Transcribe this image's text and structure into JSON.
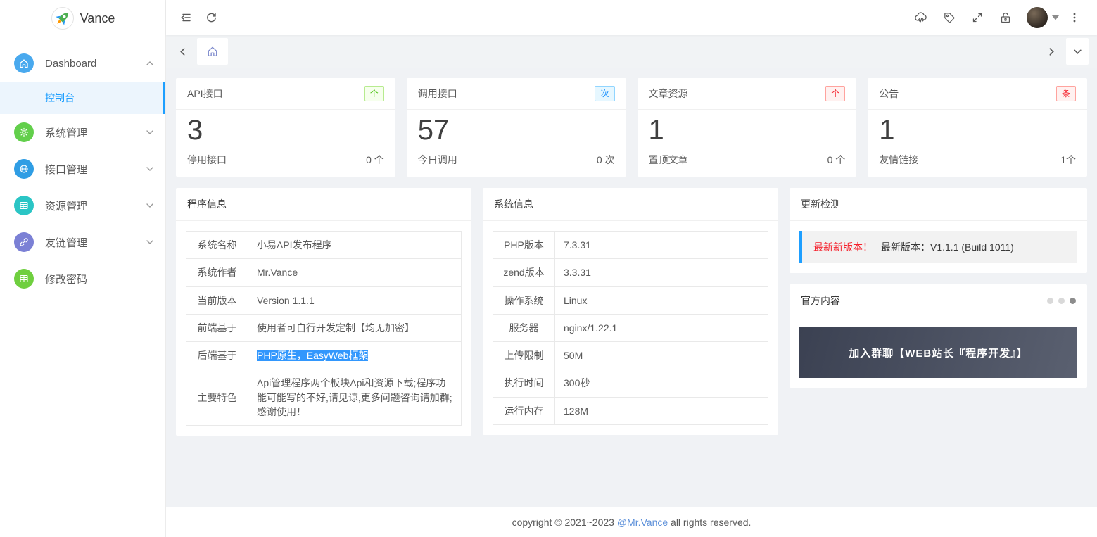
{
  "app_title": "Vance",
  "sidebar": {
    "logo_text": "Vance",
    "menu": [
      {
        "label": "Dashboard",
        "icon": "home-icon",
        "icon_color": "#49a9ee",
        "expanded": true,
        "children": [
          {
            "label": "控制台",
            "active": true
          }
        ]
      },
      {
        "label": "系统管理",
        "icon": "gear-icon",
        "icon_color": "#62cf4b",
        "collapsible": true
      },
      {
        "label": "接口管理",
        "icon": "globe-icon",
        "icon_color": "#2f9de4",
        "collapsible": true
      },
      {
        "label": "资源管理",
        "icon": "table-icon",
        "icon_color": "#2bc5c5",
        "collapsible": true
      },
      {
        "label": "友链管理",
        "icon": "link-icon",
        "icon_color": "#7b80d5",
        "collapsible": true
      },
      {
        "label": "修改密码",
        "icon": "grid-icon",
        "icon_color": "#6fcf3f",
        "collapsible": false
      }
    ]
  },
  "header": {
    "left_icons": [
      "collapse-menu-icon",
      "refresh-icon"
    ],
    "right_icons": [
      "cloud-code-icon",
      "tag-icon",
      "fullscreen-icon",
      "unlock-icon",
      "avatar",
      "caret-down-icon",
      "kebab-menu-icon"
    ]
  },
  "tabstrip": {
    "icons": [
      "chevron-left-icon",
      "home-tab-icon",
      "chevron-right-icon",
      "chevron-down-icon"
    ]
  },
  "stat_cards": [
    {
      "title": "API接口",
      "badge": "个",
      "badge_color": "green",
      "value": "3",
      "footer_label": "停用接口",
      "footer_value": "0 个"
    },
    {
      "title": "调用接口",
      "badge": "次",
      "badge_color": "blue",
      "value": "57",
      "footer_label": "今日调用",
      "footer_value": "0 次"
    },
    {
      "title": "文章资源",
      "badge": "个",
      "badge_color": "red",
      "value": "1",
      "footer_label": "置顶文章",
      "footer_value": "0 个"
    },
    {
      "title": "公告",
      "badge": "条",
      "badge_color": "red",
      "value": "1",
      "footer_label": "友情链接",
      "footer_value": "1个"
    }
  ],
  "program_info": {
    "title": "程序信息",
    "rows": [
      {
        "label": "系统名称",
        "value": "小易API发布程序"
      },
      {
        "label": "系统作者",
        "value": "Mr.Vance"
      },
      {
        "label": "当前版本",
        "value": "Version 1.1.1"
      },
      {
        "label": "前端基于",
        "value": "使用者可自行开发定制【均无加密】"
      },
      {
        "label": "后端基于",
        "value": "PHP原生，EasyWeb框架",
        "highlighted": true
      },
      {
        "label": "主要特色",
        "value": "Api管理程序两个板块Api和资源下载;程序功能可能写的不好,请见谅,更多问题咨询请加群;感谢使用！"
      }
    ]
  },
  "system_info": {
    "title": "系统信息",
    "rows": [
      {
        "label": "PHP版本",
        "value": "7.3.31"
      },
      {
        "label": "zend版本",
        "value": "3.3.31"
      },
      {
        "label": "操作系统",
        "value": "Linux"
      },
      {
        "label": "服务器",
        "value": "nginx/1.22.1"
      },
      {
        "label": "上传限制",
        "value": "50M"
      },
      {
        "label": "执行时间",
        "value": "300秒"
      },
      {
        "label": "运行内存",
        "value": "128M"
      }
    ]
  },
  "update_panel": {
    "title": "更新检测",
    "alert_highlight": "最新新版本！",
    "alert_text": "最新版本：V1.1.1 (Build 1011)"
  },
  "official_panel": {
    "title": "官方内容",
    "dots_total": 3,
    "active_dot_index": 2,
    "banner_text": "加入群聊【WEB站长『程序开发』】"
  },
  "footer": {
    "text_before": "copyright © 2021~2023 ",
    "link": "@Mr.Vance",
    "text_after": " all rights reserved."
  },
  "colors": {
    "primary": "#1e9fff",
    "content_background": "#f0f2f5",
    "selection_highlight": "#3297fd",
    "tag_green": "#52c41a",
    "tag_blue": "#1890ff",
    "tag_red": "#f5222d",
    "banner_gradient_start": "#3b4152",
    "banner_gradient_end": "#5a6070"
  }
}
